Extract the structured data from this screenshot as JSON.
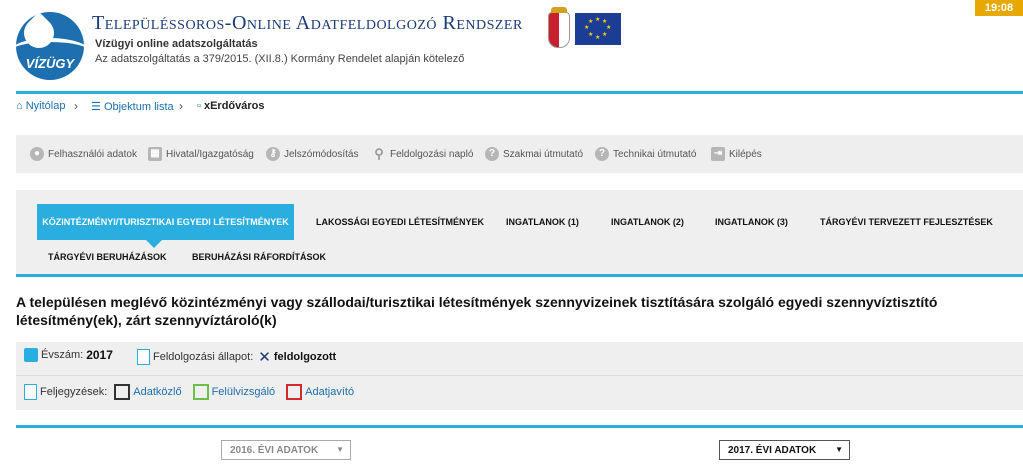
{
  "header": {
    "title": "Településsoros-Online Adatfeldolgozó Rendszer",
    "subtitle": "Vízügyi online adatszolgáltatás",
    "description": "Az adatszolgáltatás a 379/2015. (XII.8.) Kormány Rendelet alapján kötelező",
    "logo_text": "VÍZÜGY",
    "clock": "19:08"
  },
  "breadcrumb": {
    "home": "Nyitólap",
    "list": "Objektum lista",
    "current": "xErdőváros"
  },
  "toolbar": {
    "items": [
      {
        "label": "Felhasználói adatok",
        "icon": "user-icon"
      },
      {
        "label": "Hivatal/Igazgatóság",
        "icon": "building-icon"
      },
      {
        "label": "Jelszómódosítás",
        "icon": "key-icon"
      },
      {
        "label": "Feldolgozási napló",
        "icon": "search-icon"
      },
      {
        "label": "Szakmai útmutató",
        "icon": "help-icon"
      },
      {
        "label": "Technikai útmutató",
        "icon": "help-icon"
      },
      {
        "label": "Kilépés",
        "icon": "logout-icon"
      }
    ]
  },
  "tabs": [
    {
      "label": "Közintézményi/turisztikai egyedi létesítmények",
      "active": true
    },
    {
      "label": "Lakossági egyedi létesítmények"
    },
    {
      "label": "Ingatlanok (1)"
    },
    {
      "label": "Ingatlanok (2)"
    },
    {
      "label": "Ingatlanok (3)"
    },
    {
      "label": "Tárgyévi tervezett fejlesztések"
    },
    {
      "label": "Tárgyévi beruházások"
    },
    {
      "label": "Beruházási ráfordítások"
    }
  ],
  "main": {
    "heading": "A településen meglévő közintézményi vagy szállodai/turisztikai létesítmények szennyvizeinek tisztítására szolgáló egyedi szennyvíztisztító létesítmény(ek), zárt szennyvíztároló(k)",
    "year_label": "Évszám:",
    "year_value": "2017",
    "status_label": "Feldolgozási állapot:",
    "status_value": "feldolgozott",
    "notes_label": "Feljegyzések:",
    "notes": [
      "Adatközlő",
      "Felülvizsgáló",
      "Adatjavító"
    ]
  },
  "selects": {
    "left": "2016. ÉVI ADATOK",
    "right": "2017. ÉVI ADATOK"
  },
  "colors": {
    "accent": "#2aaee0",
    "brand": "#1d6fb0",
    "clock": "#e7a800"
  }
}
